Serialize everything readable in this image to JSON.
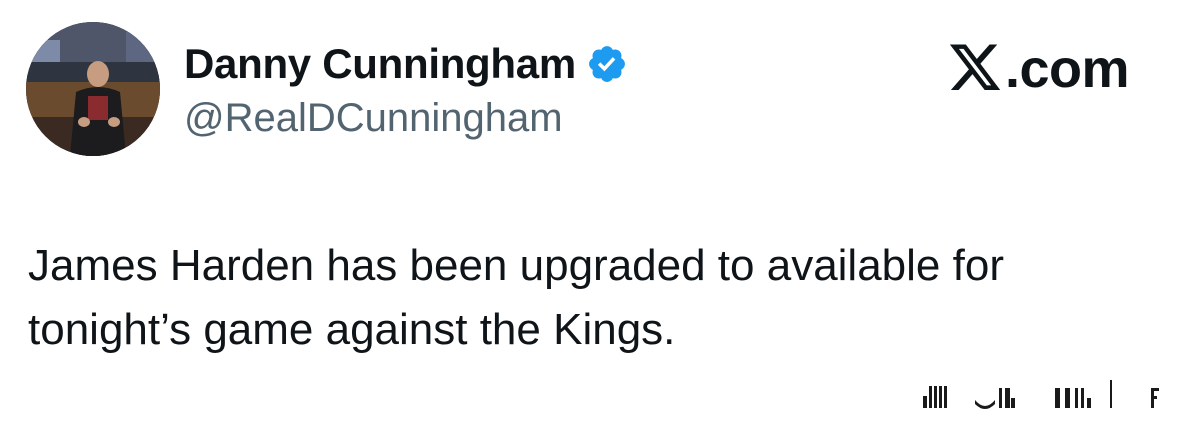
{
  "author": {
    "display_name": "Danny Cunningham",
    "handle": "@RealDCunningham",
    "verified": true,
    "verified_icon": "verified-badge-icon",
    "verified_color": "#1d9bf0"
  },
  "brand": {
    "logo_icon": "x-logo-icon",
    "text": ".com"
  },
  "tweet": {
    "lines": [
      "James Harden has been upgraded to available for",
      "tonight’s game against the Kings."
    ]
  },
  "colors": {
    "text_primary": "#0f1419",
    "text_secondary": "#536471",
    "background": "#ffffff"
  }
}
